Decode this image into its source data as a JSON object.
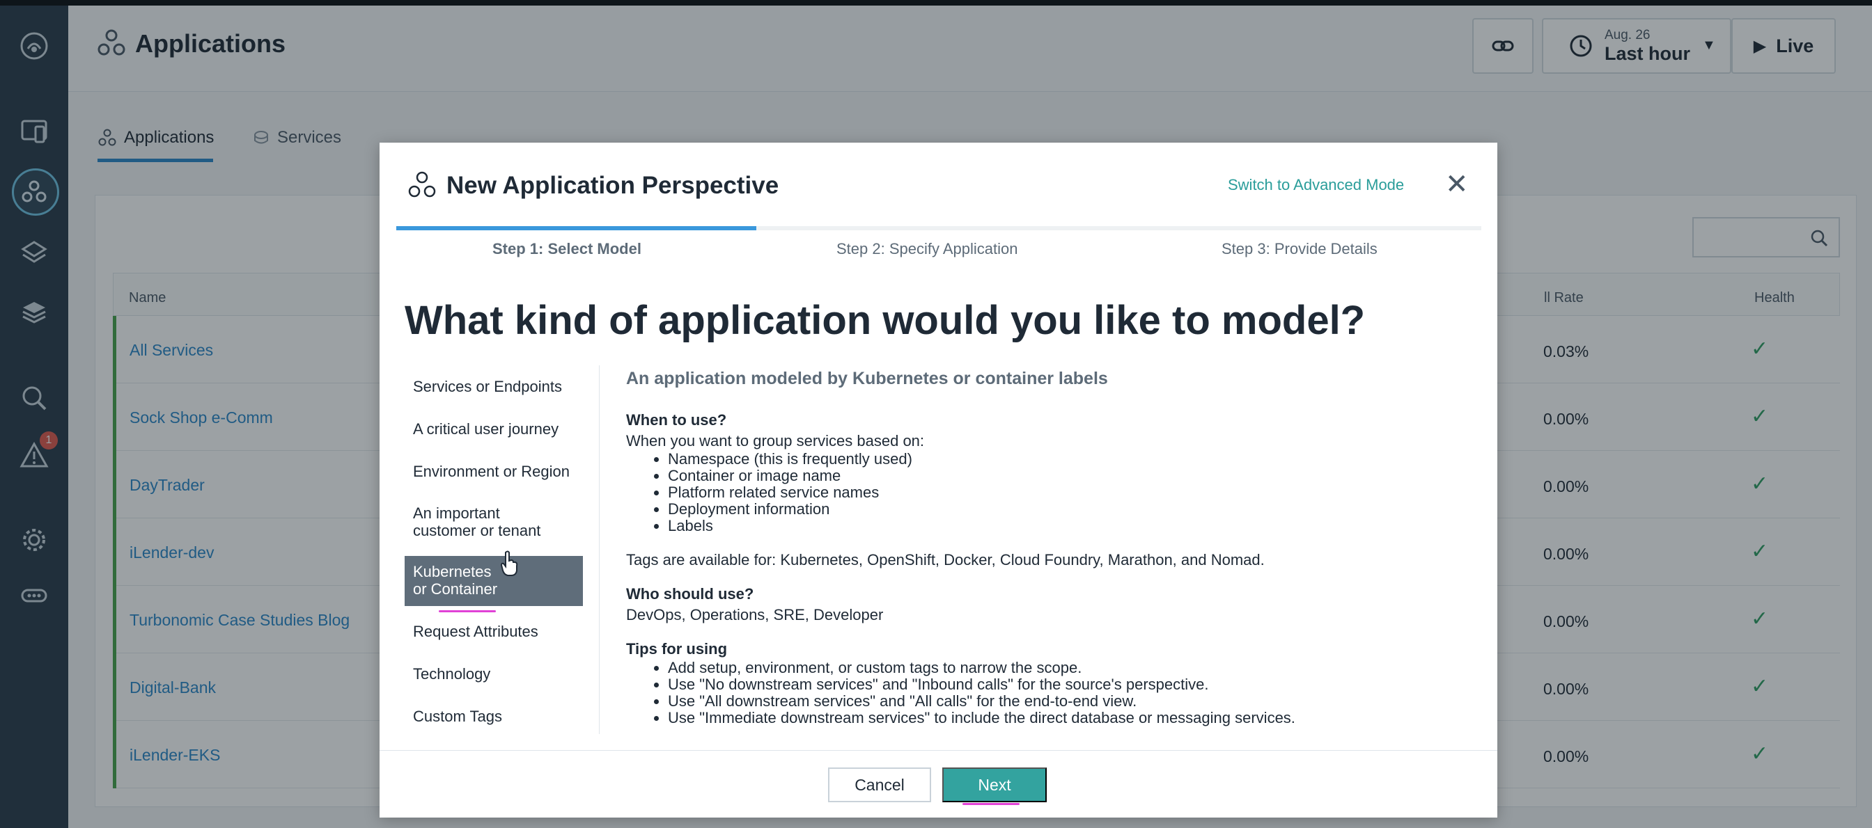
{
  "header": {
    "title": "Applications",
    "time_date": "Aug. 26",
    "time_range": "Last hour",
    "live_label": "Live"
  },
  "tabs": [
    {
      "label": "Applications",
      "icon": "applications-icon"
    },
    {
      "label": "Services",
      "icon": "services-icon"
    }
  ],
  "table": {
    "columns": [
      "Name",
      "ll Rate",
      "Health"
    ],
    "rows": [
      {
        "name": "All Services",
        "rate": "0.03%"
      },
      {
        "name": "Sock Shop e-Comm",
        "rate": "0.00%"
      },
      {
        "name": "DayTrader",
        "rate": "0.00%"
      },
      {
        "name": "iLender-dev",
        "rate": "0.00%"
      },
      {
        "name": "Turbonomic Case Studies Blog",
        "rate": "0.00%"
      },
      {
        "name": "Digital-Bank",
        "rate": "0.00%"
      },
      {
        "name": "iLender-EKS",
        "rate": "0.00%"
      }
    ]
  },
  "sidebar": {
    "alerts_badge": "1"
  },
  "modal": {
    "title": "New Application Perspective",
    "advanced_link": "Switch to Advanced Mode",
    "steps": [
      "Step 1: Select Model",
      "Step 2: Specify Application",
      "Step 3: Provide Details"
    ],
    "question": "What kind of application would you like to model?",
    "options": [
      "Services or Endpoints",
      "A critical user journey",
      "Environment or Region",
      "An important customer or tenant",
      "Kubernetes or Container",
      "Request Attributes",
      "Technology",
      "Custom Tags"
    ],
    "detail": {
      "title": "An application modeled by Kubernetes or container labels",
      "when_heading": "When to use?",
      "when_text": "When you want to group services based on:",
      "when_items": [
        "Namespace (this is frequently used)",
        "Container or image name",
        "Platform related service names",
        "Deployment information",
        "Labels"
      ],
      "tags_text": "Tags are available for: Kubernetes, OpenShift, Docker, Cloud Foundry, Marathon, and Nomad.",
      "who_heading": "Who should use?",
      "who_text": "DevOps, Operations, SRE, Developer",
      "tips_heading": "Tips for using",
      "tips_items": [
        "Add setup, environment, or custom tags to narrow the scope.",
        "Use \"No downstream services\" and \"Inbound calls\" for the source's perspective.",
        "Use \"All downstream services\" and \"All calls\" for the end-to-end view.",
        "Use \"Immediate downstream services\" to include the direct database or messaging services."
      ]
    },
    "cancel_label": "Cancel",
    "next_label": "Next"
  },
  "colors": {
    "accent_teal": "#33a39f",
    "link_blue": "#2b87c8",
    "rail_bg": "#2a3c4a",
    "annotation_pink": "#e041d6"
  }
}
